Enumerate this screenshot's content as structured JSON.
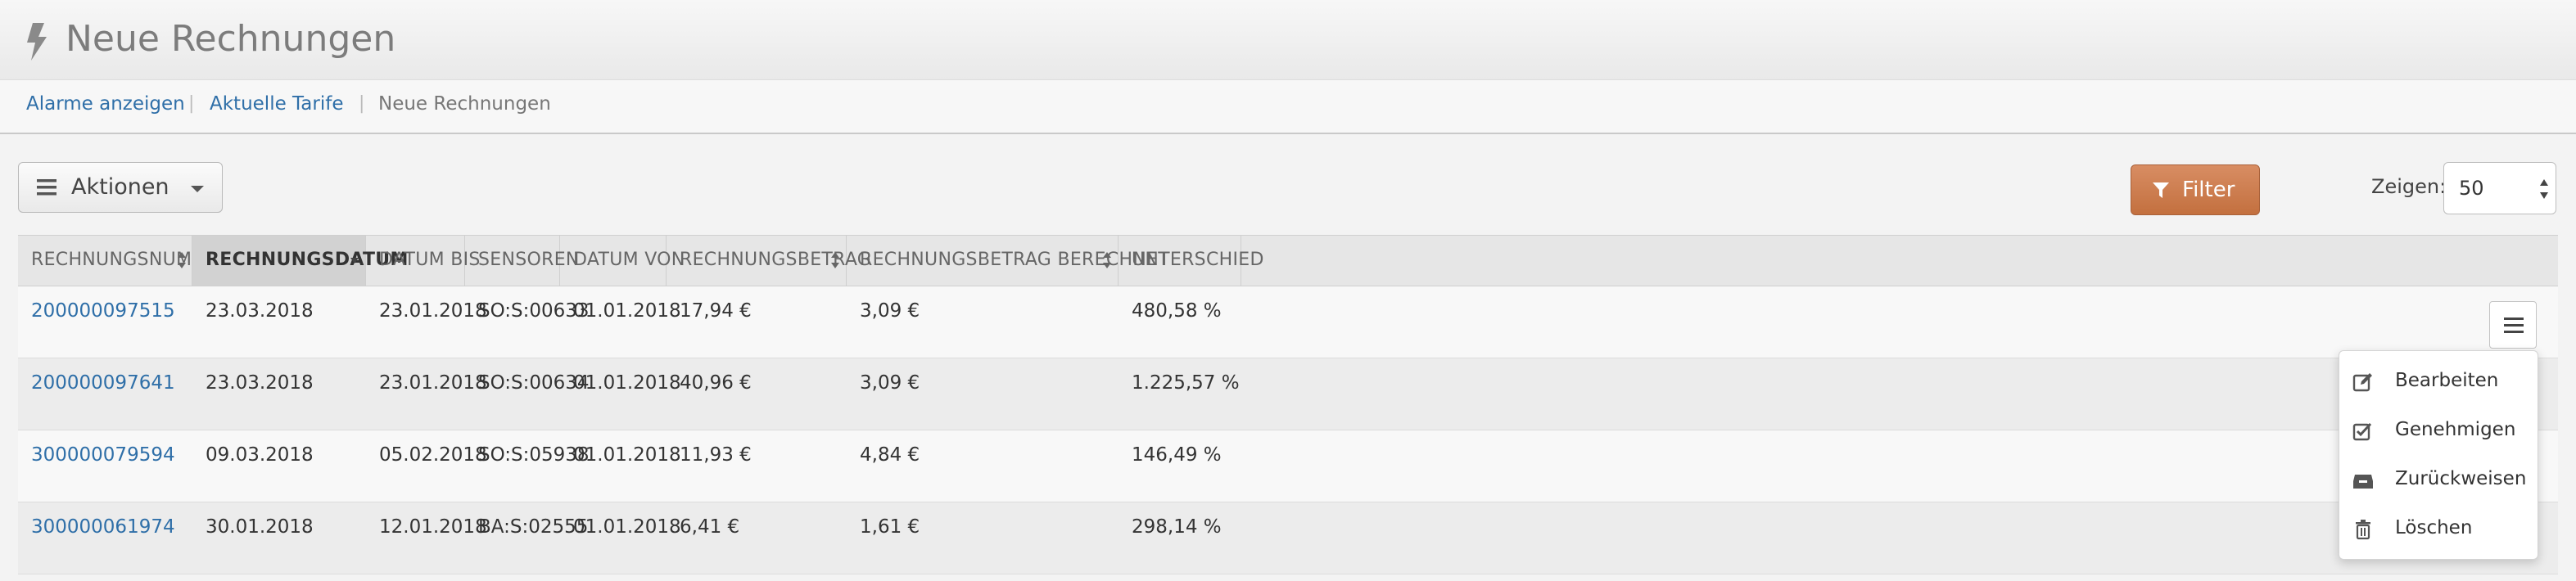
{
  "header": {
    "title": "Neue Rechnungen",
    "icon": "bolt-icon"
  },
  "breadcrumbs": [
    {
      "label": "Alarme anzeigen",
      "link": true
    },
    {
      "label": "Aktuelle Tarife",
      "link": true
    },
    {
      "label": "Neue Rechnungen",
      "link": false
    }
  ],
  "toolbar": {
    "actions_label": "Aktionen",
    "filter_label": "Filter",
    "show_label": "Zeigen:",
    "show_value": "50"
  },
  "colors": {
    "link": "#2f6fa8",
    "filter_button": "#c97a4b"
  },
  "table": {
    "columns": [
      "RECHNUNGSNUMMER",
      "RECHNUNGSDATUM",
      "DATUM BIS",
      "SENSOREN",
      "DATUM VON",
      "RECHNUNGSBETRAG",
      "RECHNUNGSBETRAG BERECHNET",
      "UNTERSCHIED"
    ],
    "sorted_column": "RECHNUNGSDATUM",
    "rows": [
      [
        "200000097515",
        "23.03.2018",
        "23.01.2018",
        "SO:S:00633",
        "01.01.2018",
        "17,94 €",
        "3,09 €",
        "480,58 %"
      ],
      [
        "200000097641",
        "23.03.2018",
        "23.01.2018",
        "SO:S:00634",
        "01.01.2018",
        "40,96 €",
        "3,09 €",
        "1.225,57 %"
      ],
      [
        "300000079594",
        "09.03.2018",
        "05.02.2018",
        "SO:S:05938",
        "01.01.2018",
        "11,93 €",
        "4,84 €",
        "146,49 %"
      ],
      [
        "300000061974",
        "30.01.2018",
        "12.01.2018",
        "BA:S:02555",
        "01.01.2018",
        "6,41 €",
        "1,61 €",
        "298,14 %"
      ]
    ]
  },
  "row_menu": {
    "items": [
      {
        "label": "Bearbeiten",
        "icon": "edit-icon"
      },
      {
        "label": "Genehmigen",
        "icon": "check-square-icon"
      },
      {
        "label": "Zurückweisen",
        "icon": "inbox-icon"
      },
      {
        "label": "Löschen",
        "icon": "trash-icon"
      }
    ]
  }
}
